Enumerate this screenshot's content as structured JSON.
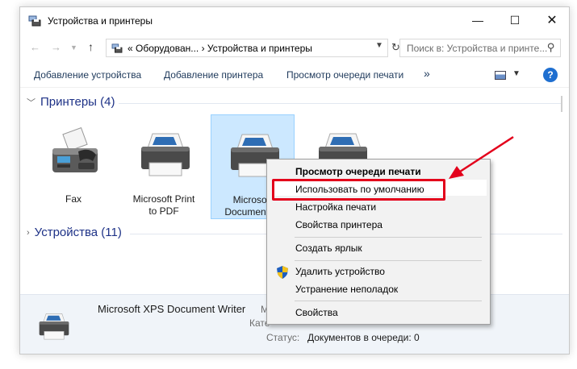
{
  "window": {
    "title": "Устройства и принтеры",
    "controls": {
      "minimize": "—",
      "maximize": "☐",
      "close": "✕"
    }
  },
  "address_bar": {
    "path": "«  Оборудован...  ›  Устройства и принтеры",
    "search_placeholder": "Поиск в: Устройства и принте..."
  },
  "toolbar": {
    "add_device": "Добавление устройства",
    "add_printer": "Добавление принтера",
    "view_queue": "Просмотр очереди печати",
    "more": "»",
    "help": "?"
  },
  "groups": {
    "printers": "Принтеры (4)",
    "devices": "Устройства (11)"
  },
  "devices": [
    {
      "name": "Fax",
      "line2": ""
    },
    {
      "name": "Microsoft Print",
      "line2": "to PDF"
    },
    {
      "name": "Microsoft",
      "line2": "Document W",
      "selected": true
    },
    {
      "name": "",
      "line2": ""
    }
  ],
  "details": {
    "name": "Microsoft XPS Document Writer",
    "trunc_label": "М",
    "category_label": "Кате",
    "status_label": "Статус:",
    "status_value": "Документов в очереди: 0"
  },
  "context_menu": {
    "items": [
      "Просмотр очереди печати",
      "Использовать по умолчанию",
      "Настройка печати",
      "Свойства принтера",
      "Создать ярлык",
      "Удалить устройство",
      "Устранение неполадок",
      "Свойства"
    ]
  },
  "colors": {
    "accent_red": "#e3001b",
    "group_header": "#1e3287",
    "selection": "#cce8ff",
    "link_text": "#1e395b"
  }
}
